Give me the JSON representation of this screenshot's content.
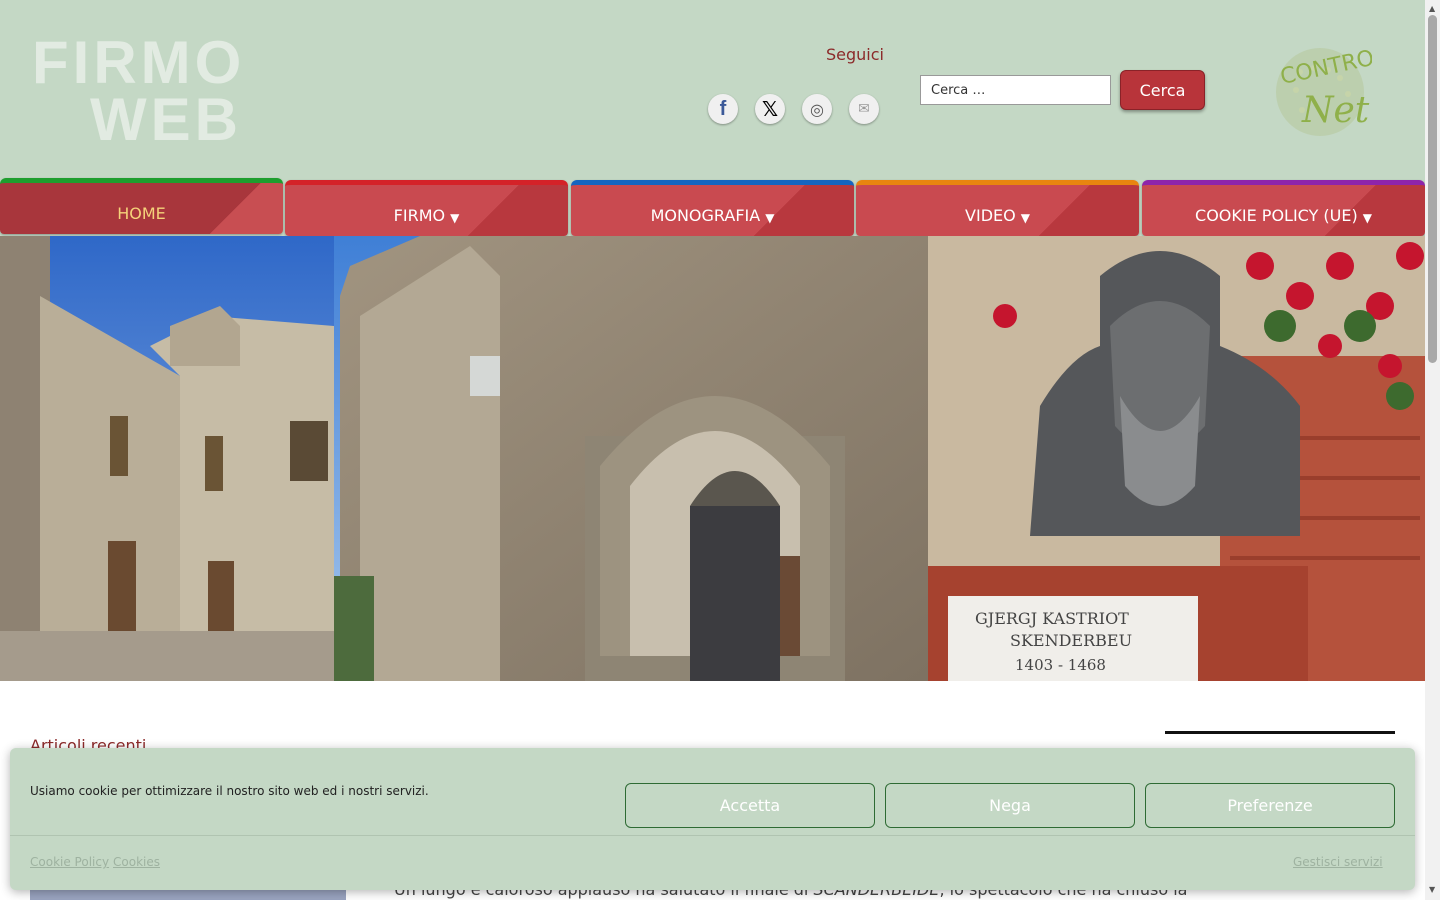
{
  "header": {
    "logo_line1": "FIRMO",
    "logo_line2": "WEB",
    "follow_label": "Seguici",
    "social": [
      {
        "icon": "facebook-icon",
        "glyph": "f"
      },
      {
        "icon": "x-icon",
        "glyph": "𝕏"
      },
      {
        "icon": "instagram-icon",
        "glyph": "◎"
      },
      {
        "icon": "mail-icon",
        "glyph": "✉"
      }
    ],
    "search": {
      "placeholder": "Cerca …",
      "button_label": "Cerca"
    },
    "partner_logo_line1": "CONTRO",
    "partner_logo_line2": "Net"
  },
  "nav": {
    "items": [
      {
        "label": "HOME",
        "accent": "#1e9e2e",
        "active": true
      },
      {
        "label": "FIRMO",
        "accent": "#d42228",
        "caret": "▼"
      },
      {
        "label": "MONOGRAFIA",
        "accent": "#1565c0",
        "caret": "▼"
      },
      {
        "label": "VIDEO",
        "accent": "#e8850f",
        "caret": "▼"
      },
      {
        "label": "COOKIE POLICY (UE)",
        "accent": "#8e24aa",
        "caret": "▼"
      }
    ]
  },
  "hero": {
    "plaque_line1": "GJERGJ KASTRIOT",
    "plaque_line2": "SKENDERBEU",
    "plaque_line3": "1403 - 1468"
  },
  "content": {
    "recent_title": "Articoli recenti",
    "article_excerpt_start": "Un lungo e caloroso applauso ha salutato il finale di ",
    "article_excerpt_em": "SCANDERBEIDE",
    "article_excerpt_end": ", lo spettacolo che ha chiuso la"
  },
  "cookie_banner": {
    "message": "Usiamo cookie per ottimizzare il nostro sito web ed i nostri servizi.",
    "accept_label": "Accetta",
    "deny_label": "Nega",
    "preferences_label": "Preferenze",
    "link_policy": "Cookie Policy",
    "link_cookies": "Cookies",
    "link_manage": "Gestisci servizi"
  },
  "colors": {
    "header_bg": "#c4d8c5",
    "brand_red": "#b8343a",
    "heading_red": "#8c2a2a"
  }
}
